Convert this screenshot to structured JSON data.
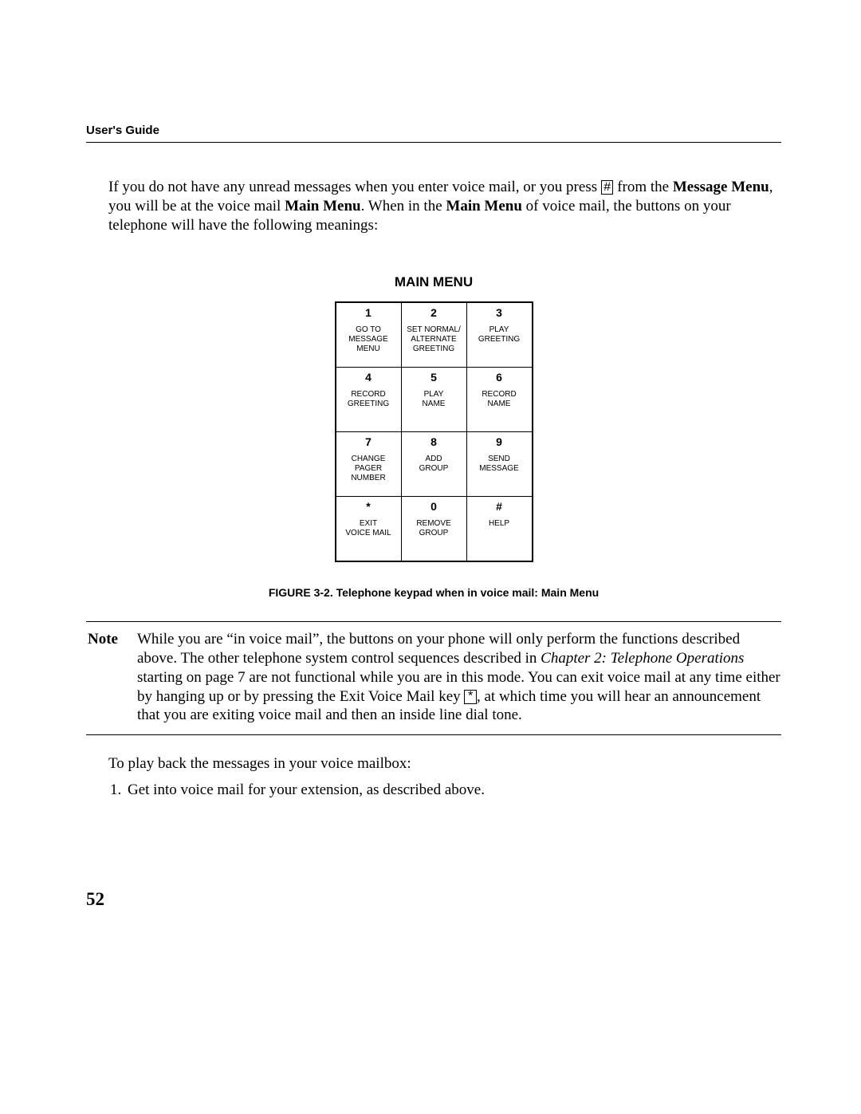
{
  "header": "User's Guide",
  "intro": {
    "p1a": "If you do not have any unread messages when you enter voice mail, or you press ",
    "k1": "#",
    "p1b": " from the ",
    "b1": "Message Menu",
    "p1c": ", you will be at the voice mail ",
    "b2": "Main Menu",
    "p1d": ".  When in the ",
    "b3": "Main Menu",
    "p1e": " of voice mail, the buttons on your telephone will have the following meanings:"
  },
  "keypad": {
    "title": "MAIN MENU",
    "keys": [
      {
        "n": "1",
        "l": "GO TO\nMESSAGE\nMENU"
      },
      {
        "n": "2",
        "l": "SET NORMAL/\nALTERNATE\nGREETING"
      },
      {
        "n": "3",
        "l": "PLAY\nGREETING"
      },
      {
        "n": "4",
        "l": "RECORD\nGREETING"
      },
      {
        "n": "5",
        "l": "PLAY\nNAME"
      },
      {
        "n": "6",
        "l": "RECORD\nNAME"
      },
      {
        "n": "7",
        "l": "CHANGE\nPAGER\nNUMBER"
      },
      {
        "n": "8",
        "l": "ADD\nGROUP"
      },
      {
        "n": "9",
        "l": "SEND\nMESSAGE"
      },
      {
        "n": "*",
        "l": "EXIT\nVOICE MAIL"
      },
      {
        "n": "0",
        "l": "REMOVE\nGROUP"
      },
      {
        "n": "#",
        "l": "HELP"
      }
    ]
  },
  "figure_caption": "FIGURE 3-2. Telephone keypad when in voice mail: Main Menu",
  "note": {
    "label": "Note",
    "t1": "While you are “in voice mail”, the buttons on your phone will only perform the functions described above. The other telephone system control sequences described in ",
    "ital": "Chapter 2: Telephone Operations",
    "t2": " starting on page 7 are not functional while you are in this mode. You can exit voice mail at any time either by hanging up or by pressing the Exit Voice Mail key ",
    "k": "*",
    "t3": ", at which time you will hear an announcement that you are exiting voice mail and then an inside line dial tone."
  },
  "post": {
    "line": "To play back the messages in your voice mailbox:",
    "num": "1.",
    "item": "Get into voice mail for your extension, as described above."
  },
  "page_number": "52"
}
